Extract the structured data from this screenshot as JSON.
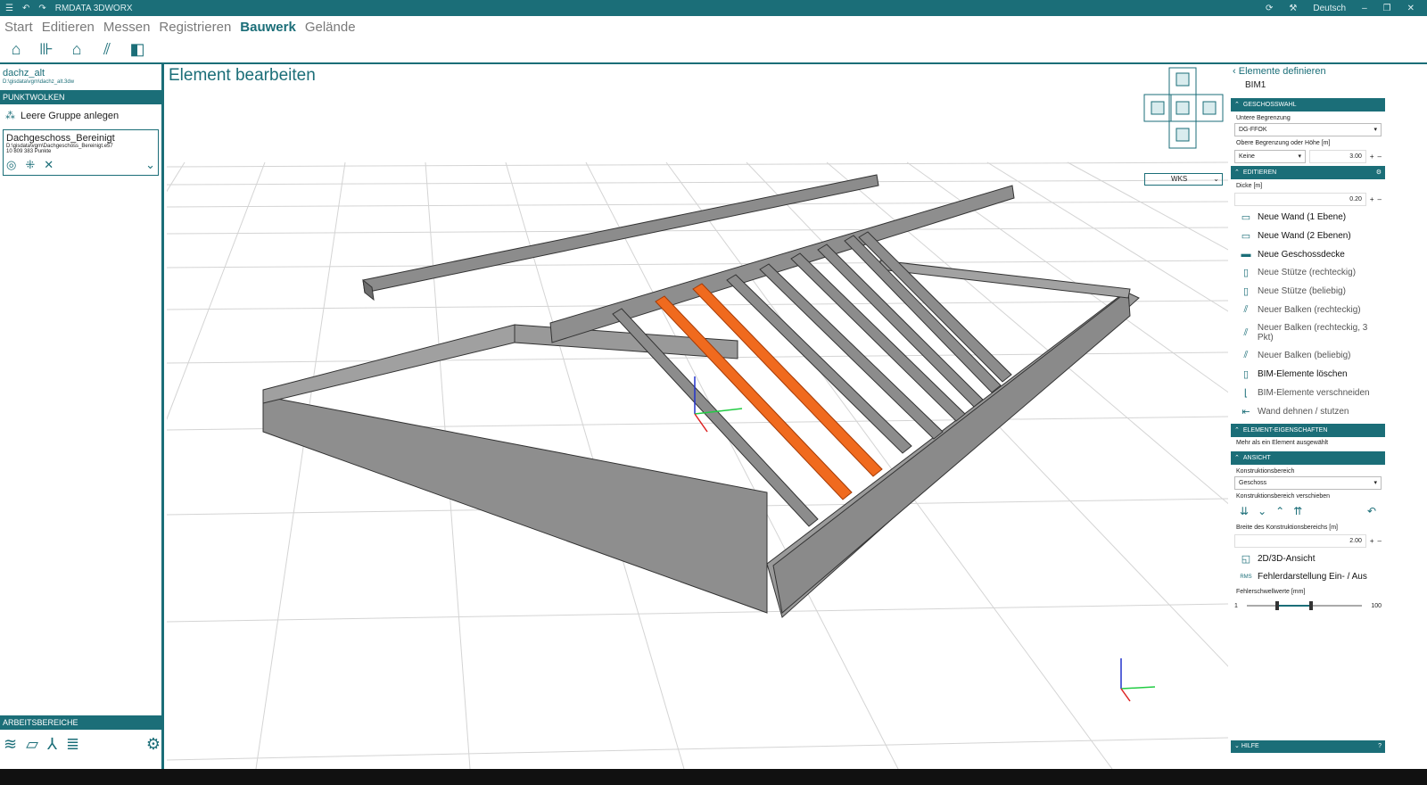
{
  "app": {
    "title": "RMDATA 3DWORX",
    "language": "Deutsch"
  },
  "menu": [
    "Start",
    "Editieren",
    "Messen",
    "Registrieren",
    "Bauwerk",
    "Gelände"
  ],
  "menu_active": "Bauwerk",
  "project": {
    "name": "dachz_alt",
    "path": "D:\\gisdata\\vgm\\dachz_alt.3dw"
  },
  "left": {
    "section": "PUNKTWOLKEN",
    "group_button": "Leere Gruppe anlegen",
    "cloud": {
      "name": "Dachgeschoss_Bereinigt",
      "path": "D:\\gisdata\\vgm\\Dachgeschoss_Bereinigt.e57",
      "points": "10 809 383 Punkte"
    },
    "workspaces": "ARBEITSBEREICHE"
  },
  "viewport": {
    "title": "Element bearbeiten",
    "coord_system": "WKS"
  },
  "right": {
    "back_label": "Elemente definieren",
    "subtitle": "BIM1",
    "geschoss_head": "GESCHOSSWAHL",
    "lower_label": "Untere Begrenzung",
    "lower_value": "DG-FFOK",
    "upper_label": "Obere Begrenzung oder Höhe [m]",
    "upper_value": "Keine",
    "upper_height": "3.00",
    "edit_head": "EDITIEREN",
    "thickness_label": "Dicke [m]",
    "thickness_value": "0.20",
    "tools": [
      "Neue Wand (1 Ebene)",
      "Neue Wand (2 Ebenen)",
      "Neue Geschossdecke",
      "Neue Stütze (rechteckig)",
      "Neue Stütze (beliebig)",
      "Neuer Balken (rechteckig)",
      "Neuer Balken (rechteckig, 3 Pkt)",
      "Neuer Balken (beliebig)",
      "BIM-Elemente löschen",
      "BIM-Elemente verschneiden",
      "Wand dehnen / stutzen"
    ],
    "props_head": "ELEMENT-EIGENSCHAFTEN",
    "props_info": "Mehr als ein Element ausgewählt",
    "view_head": "ANSICHT",
    "construct_label": "Konstruktionsbereich",
    "construct_value": "Geschoss",
    "shift_label": "Konstruktionsbereich verschieben",
    "width_label": "Breite des Konstruktionsbereichs [m]",
    "width_value": "2.00",
    "view_toggle": "2D/3D-Ansicht",
    "error_toggle": "Fehlerdarstellung Ein- / Aus",
    "rms": "RMS",
    "threshold_label": "Fehlerschwellwerte [mm]",
    "threshold_min": "1",
    "threshold_max": "100",
    "help": "HILFE"
  },
  "colors": {
    "accent": "#1b6e78",
    "selected_beam": "#f06a1e",
    "beam": "#8c8c8c"
  }
}
